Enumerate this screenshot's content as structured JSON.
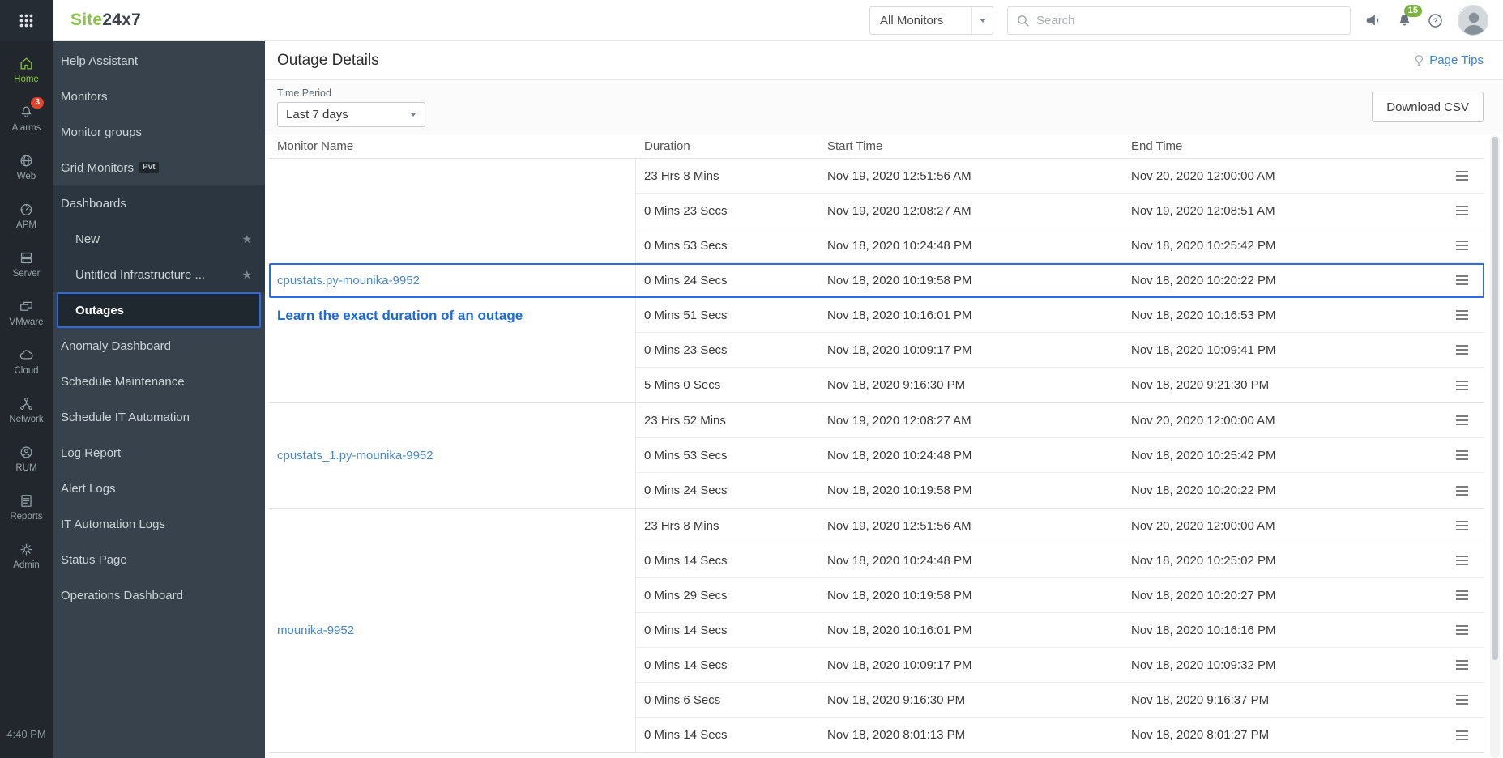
{
  "topbar": {
    "logo_part1": "Site",
    "logo_part2": "24x7",
    "monitor_filter": "All Monitors",
    "search_placeholder": "Search",
    "notification_count": "15"
  },
  "rail": {
    "items": [
      {
        "label": "Home",
        "icon": "home",
        "active": true
      },
      {
        "label": "Alarms",
        "icon": "bell",
        "badge": "3"
      },
      {
        "label": "Web",
        "icon": "globe"
      },
      {
        "label": "APM",
        "icon": "gauge"
      },
      {
        "label": "Server",
        "icon": "server"
      },
      {
        "label": "VMware",
        "icon": "vmware"
      },
      {
        "label": "Cloud",
        "icon": "cloud"
      },
      {
        "label": "Network",
        "icon": "network"
      },
      {
        "label": "RUM",
        "icon": "rum"
      },
      {
        "label": "Reports",
        "icon": "reports"
      },
      {
        "label": "Admin",
        "icon": "gear"
      }
    ],
    "time": "4:40 PM"
  },
  "sidebar": {
    "items": [
      {
        "label": "Help Assistant"
      },
      {
        "label": "Monitors"
      },
      {
        "label": "Monitor groups"
      },
      {
        "label": "Grid Monitors",
        "badge": "Pvt"
      },
      {
        "label": "Dashboards",
        "block": true
      },
      {
        "label": "New",
        "block": true,
        "child": true,
        "star": true
      },
      {
        "label": "Untitled Infrastructure ...",
        "block": true,
        "child": true,
        "star": true
      },
      {
        "label": "Outages",
        "block": true,
        "active": true
      },
      {
        "label": "Anomaly Dashboard"
      },
      {
        "label": "Schedule Maintenance"
      },
      {
        "label": "Schedule IT Automation"
      },
      {
        "label": "Log Report"
      },
      {
        "label": "Alert Logs"
      },
      {
        "label": "IT Automation Logs"
      },
      {
        "label": "Status Page"
      },
      {
        "label": "Operations Dashboard"
      }
    ]
  },
  "main": {
    "title": "Outage Details",
    "page_tips": "Page Tips",
    "time_period_label": "Time Period",
    "time_period_value": "Last 7 days",
    "download_csv": "Download CSV",
    "annotation": "Learn the exact duration of an outage",
    "table": {
      "headers": [
        "Monitor Name",
        "Duration",
        "Start Time",
        "End Time"
      ],
      "groups": [
        {
          "monitor": "cpustats.py-mounika-9952",
          "rows": [
            {
              "duration": "23 Hrs 8 Mins",
              "start": "Nov 19, 2020 12:51:56 AM",
              "end": "Nov 20, 2020 12:00:00 AM"
            },
            {
              "duration": "0 Mins 23 Secs",
              "start": "Nov 19, 2020 12:08:27 AM",
              "end": "Nov 19, 2020 12:08:51 AM"
            },
            {
              "duration": "0 Mins 53 Secs",
              "start": "Nov 18, 2020 10:24:48 PM",
              "end": "Nov 18, 2020 10:25:42 PM"
            },
            {
              "duration": "0 Mins 24 Secs",
              "start": "Nov 18, 2020 10:19:58 PM",
              "end": "Nov 18, 2020 10:20:22 PM",
              "highlighted": true
            },
            {
              "duration": "0 Mins 51 Secs",
              "start": "Nov 18, 2020 10:16:01 PM",
              "end": "Nov 18, 2020 10:16:53 PM"
            },
            {
              "duration": "0 Mins 23 Secs",
              "start": "Nov 18, 2020 10:09:17 PM",
              "end": "Nov 18, 2020 10:09:41 PM"
            },
            {
              "duration": "5 Mins 0 Secs",
              "start": "Nov 18, 2020 9:16:30 PM",
              "end": "Nov 18, 2020 9:21:30 PM"
            }
          ]
        },
        {
          "monitor": "cpustats_1.py-mounika-9952",
          "rows": [
            {
              "duration": "23 Hrs 52 Mins",
              "start": "Nov 19, 2020 12:08:27 AM",
              "end": "Nov 20, 2020 12:00:00 AM"
            },
            {
              "duration": "0 Mins 53 Secs",
              "start": "Nov 18, 2020 10:24:48 PM",
              "end": "Nov 18, 2020 10:25:42 PM"
            },
            {
              "duration": "0 Mins 24 Secs",
              "start": "Nov 18, 2020 10:19:58 PM",
              "end": "Nov 18, 2020 10:20:22 PM"
            }
          ]
        },
        {
          "monitor": "mounika-9952",
          "rows": [
            {
              "duration": "23 Hrs 8 Mins",
              "start": "Nov 19, 2020 12:51:56 AM",
              "end": "Nov 20, 2020 12:00:00 AM"
            },
            {
              "duration": "0 Mins 14 Secs",
              "start": "Nov 18, 2020 10:24:48 PM",
              "end": "Nov 18, 2020 10:25:02 PM"
            },
            {
              "duration": "0 Mins 29 Secs",
              "start": "Nov 18, 2020 10:19:58 PM",
              "end": "Nov 18, 2020 10:20:27 PM"
            },
            {
              "duration": "0 Mins 14 Secs",
              "start": "Nov 18, 2020 10:16:01 PM",
              "end": "Nov 18, 2020 10:16:16 PM"
            },
            {
              "duration": "0 Mins 14 Secs",
              "start": "Nov 18, 2020 10:09:17 PM",
              "end": "Nov 18, 2020 10:09:32 PM"
            },
            {
              "duration": "0 Mins 6 Secs",
              "start": "Nov 18, 2020 9:16:30 PM",
              "end": "Nov 18, 2020 9:16:37 PM"
            },
            {
              "duration": "0 Mins 14 Secs",
              "start": "Nov 18, 2020 8:01:13 PM",
              "end": "Nov 18, 2020 8:01:27 PM"
            }
          ]
        }
      ]
    }
  },
  "colors": {
    "brand_green": "#8bc34a",
    "link_blue": "#4a87c7",
    "highlight_blue": "#2c6be4",
    "annotation_blue": "#1b6ae0",
    "alert_red": "#e0442c",
    "badge_green": "#7cb342"
  }
}
